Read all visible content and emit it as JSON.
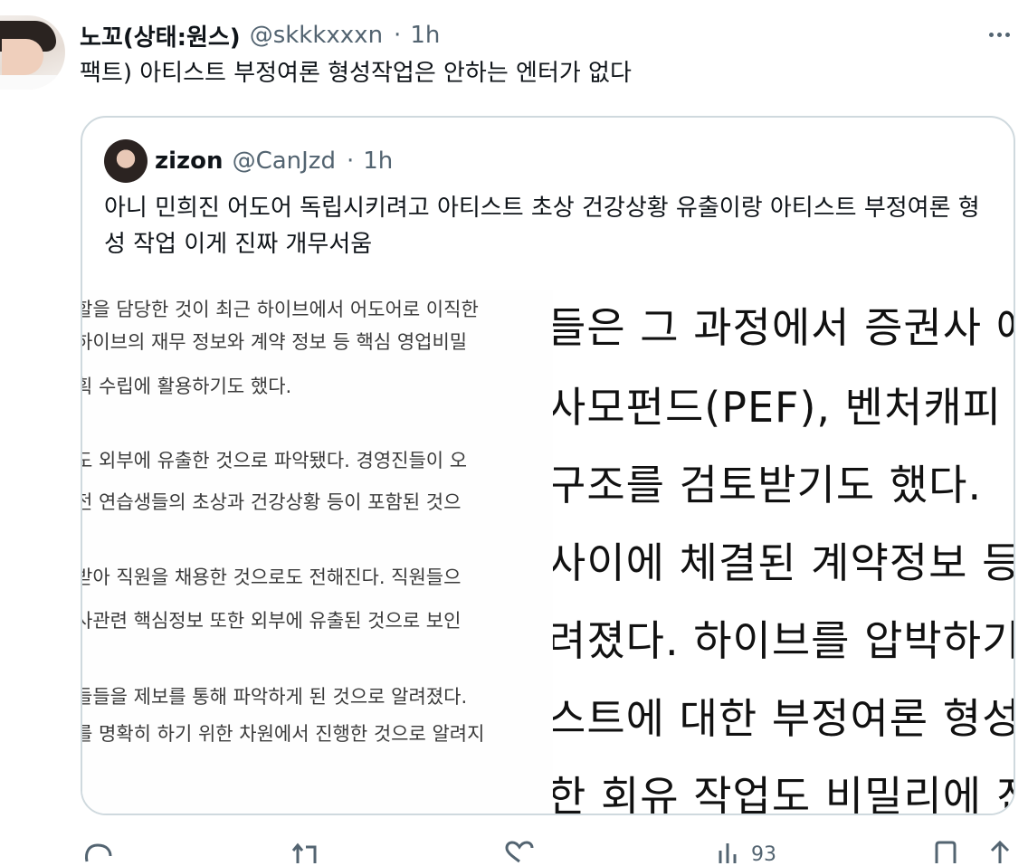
{
  "tweet": {
    "display_name": "노꼬(상태:원스)",
    "handle": "@skkkxxxn",
    "separator": "·",
    "time": "1h",
    "text": "팩트) 아티스트 부정여론 형성작업은 안하는 엔터가 없다"
  },
  "quoted": {
    "display_name": "zizon",
    "handle": "@CanJzd",
    "separator": "·",
    "time": "1h",
    "text": "아니 민희진 어도어 독립시키려고 아티스트 초상 건강상황 유출이랑 아티스트 부정여론 형성 작업 이게 진짜 개무서움",
    "image_left_lines": [
      "할을 담당한 것이 최근 하이브에서 어도어로 이직한",
      "하이브의 재무 정보와 계약 정보 등 핵심 영업비밀",
      "획 수립에 활용하기도 했다.",
      "도 외부에 유출한 것으로 파악됐다. 경영진들이 오",
      "전 연습생들의 초상과 건강상황 등이 포함된 것으",
      "받아 직원을 채용한 것으로도 전해진다. 직원들으",
      "사관련 핵심정보 또한 외부에 유출된 것으로 보인",
      "들들을 제보를 통해 파악하게 된 것으로 알려졌다.",
      "를 명확히 하기 위한 차원에서 진행한 것으로 알려지"
    ],
    "image_right_lines": [
      "들은 그 과정에서 증권사 애",
      "사모펀드(PEF), 벤처캐피",
      "구조를 검토받기도 했다.",
      "사이에 체결된 계약정보 등",
      "려졌다. 하이브를 압박하기",
      "스트에 대한 부정여론 형성",
      "한 회유 작업도 비밀리에 진"
    ]
  },
  "actions": {
    "views_count": "93",
    "icons": [
      "reply-icon",
      "retweet-icon",
      "like-icon",
      "views-icon",
      "bookmark-icon",
      "share-icon"
    ]
  },
  "colors": {
    "text": "#0f1419",
    "muted": "#536471",
    "border": "#cfd9de"
  }
}
